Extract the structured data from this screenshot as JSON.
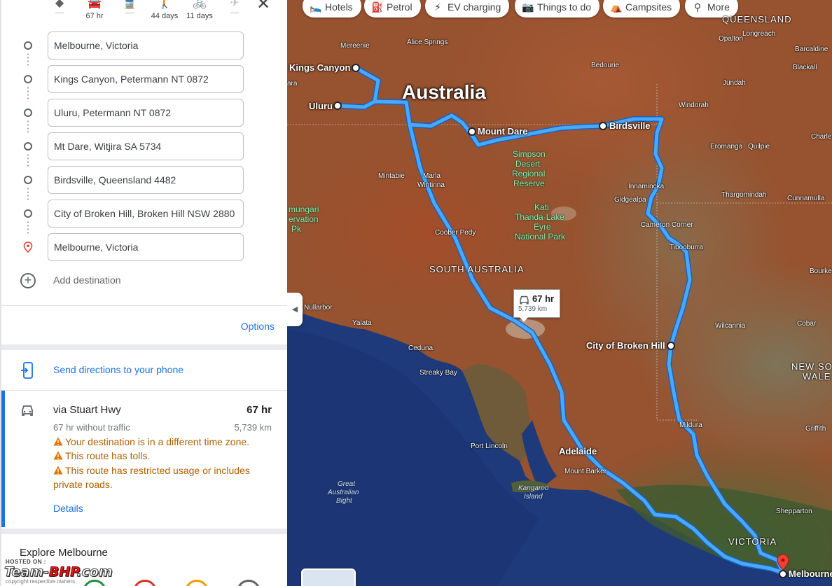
{
  "travel_modes": [
    {
      "name": "best-route",
      "label": ""
    },
    {
      "name": "driving",
      "label": "67 hr"
    },
    {
      "name": "transit",
      "label": ""
    },
    {
      "name": "walking",
      "label": "44 days"
    },
    {
      "name": "cycling",
      "label": "11 days"
    },
    {
      "name": "flights",
      "label": ""
    }
  ],
  "stops": [
    "Melbourne, Victoria",
    "Kings Canyon, Petermann NT 0872",
    "Uluru, Petermann NT 0872",
    "Mt Dare, Witjira SA 5734",
    "Birdsville, Queensland 4482",
    "City of Broken Hill, Broken Hill NSW 2880",
    "Melbourne, Victoria"
  ],
  "add_destination": "Add destination",
  "options_label": "Options",
  "send_directions": "Send directions to your phone",
  "route": {
    "title": "via Stuart Hwy",
    "time": "67 hr",
    "without_traffic": "67 hr without traffic",
    "distance": "5,739 km",
    "warnings": [
      "Your destination is in a different time zone.",
      "This route has tolls.",
      "This route has restricted usage or includes private roads."
    ],
    "details_label": "Details"
  },
  "explore_title": "Explore Melbourne",
  "watermark": {
    "hosted": "HOSTED ON :",
    "logo_a": "Team-",
    "logo_b": "BHP",
    "logo_c": ".com",
    "copyright": "copyright respective owners"
  },
  "map": {
    "chips": [
      {
        "label": "Hotels",
        "icon": "bed-icon"
      },
      {
        "label": "Petrol",
        "icon": "fuel-icon"
      },
      {
        "label": "EV charging",
        "icon": "ev-icon"
      },
      {
        "label": "Things to do",
        "icon": "camera-icon"
      },
      {
        "label": "Campsites",
        "icon": "tent-icon"
      },
      {
        "label": "More",
        "icon": "search-icon"
      }
    ],
    "country": "Australia",
    "regions": [
      "SOUTH AUSTRALIA",
      "VICTORIA",
      "QUEENSLAND",
      "NEW SO",
      "WALE"
    ],
    "cities": [
      "Kings Canyon",
      "Uluru",
      "Mount Dare",
      "Birdsville",
      "City of Broken Hill",
      "Adelaide",
      "Melbourne"
    ],
    "towns": [
      "Mereenie",
      "Alice Springs",
      "Bedourie",
      "Opalton",
      "Longreach",
      "Barcaldine",
      "Blackall",
      "Jundah",
      "Windorah",
      "Charlev",
      "Eromanga",
      "Quilpie",
      "Mintabie",
      "Marla",
      "Wintinna",
      "Innamincka",
      "Gidgealpa",
      "Thargomindah",
      "Cunnamulla",
      "Cameron Corner",
      "Tibooburra",
      "Coober Pedy",
      "Bourke",
      "Nullarbor",
      "Yalata",
      "Wilcannia",
      "Cobar",
      "Ceduna",
      "Streaky Bay",
      "Griffith",
      "Mildura",
      "Port Lincoln",
      "Mount Barker",
      "Shepparton",
      "ara",
      "mungari",
      "ervation",
      "Pk"
    ],
    "parks": [
      "Simpson",
      "Desert",
      "Regional",
      "Reserve",
      "Kati",
      "Thanda-Lake",
      "Eyre",
      "National Park"
    ],
    "sea_labels": [
      "Great",
      "Australian",
      "Bight",
      "Kangaroo",
      "Island"
    ],
    "route_box": {
      "time": "67 hr",
      "distance": "5,739 km"
    },
    "route_color": "#4aa8f5"
  }
}
